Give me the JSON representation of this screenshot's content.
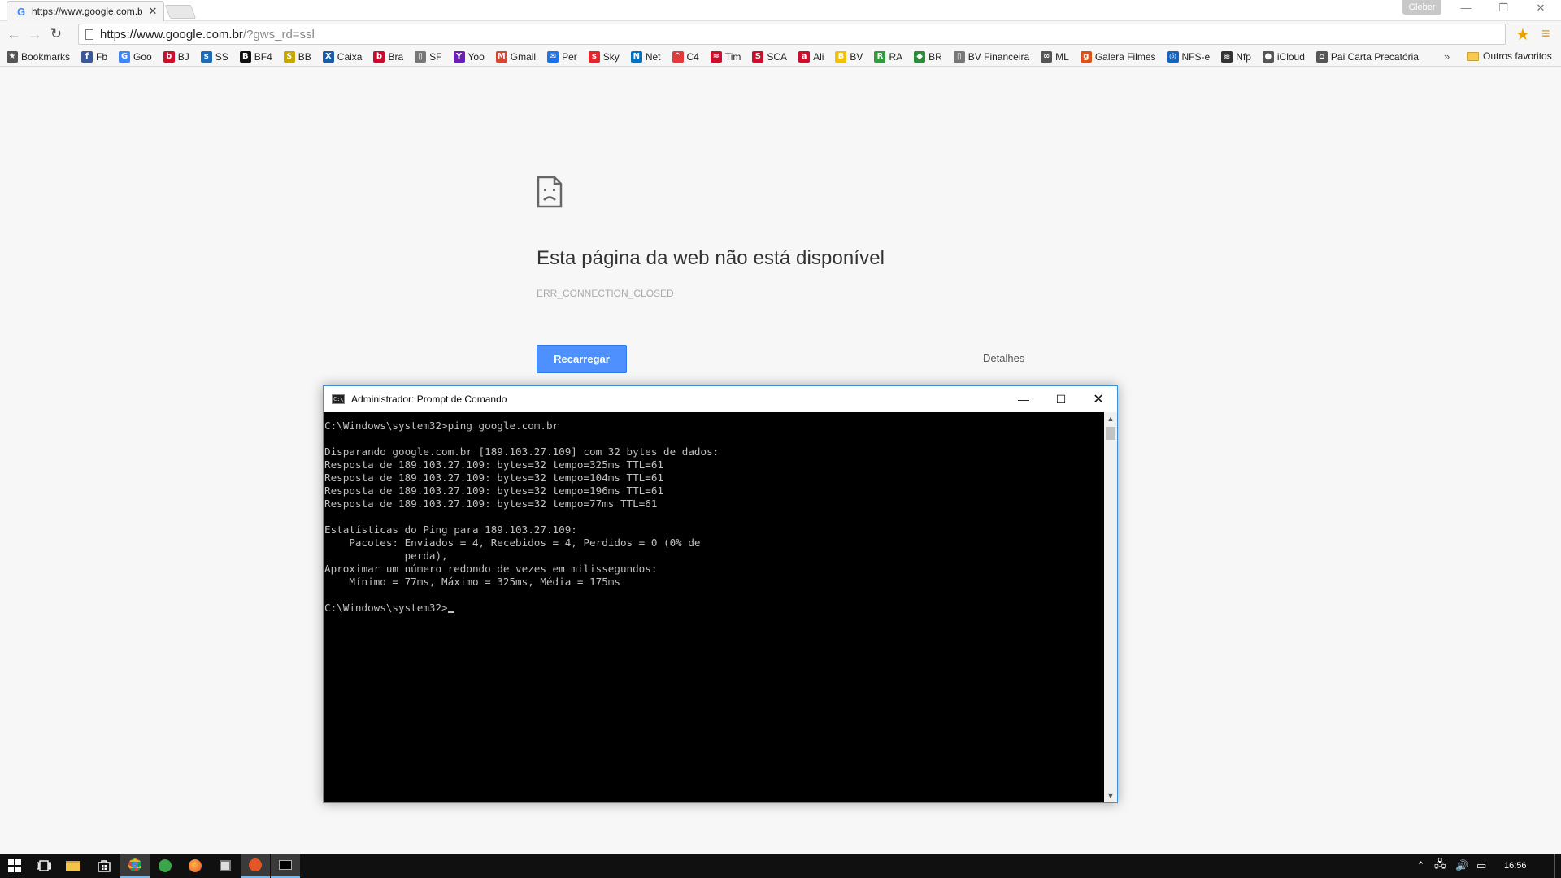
{
  "browser": {
    "tab": {
      "title": "https://www.google.com.b",
      "favicon": "G"
    },
    "profile": "Gleber",
    "url": {
      "host": "https://www.google.com.br",
      "path": "/?gws_rd=ssl"
    }
  },
  "bookmarks": {
    "items": [
      {
        "label": "Bookmarks",
        "icon": "★",
        "color": "#555555"
      },
      {
        "label": "Fb",
        "icon": "f",
        "color": "#3b5998"
      },
      {
        "label": "Goo",
        "icon": "G",
        "color": "#4285f4"
      },
      {
        "label": "BJ",
        "icon": "b",
        "color": "#c8102e"
      },
      {
        "label": "SS",
        "icon": "s",
        "color": "#1e6bb8"
      },
      {
        "label": "BF4",
        "icon": "B",
        "color": "#111111"
      },
      {
        "label": "BB",
        "icon": "$",
        "color": "#c7a500"
      },
      {
        "label": "Caixa",
        "icon": "X",
        "color": "#1c5aa6"
      },
      {
        "label": "Bra",
        "icon": "b",
        "color": "#cc092f"
      },
      {
        "label": "SF",
        "icon": "▯",
        "color": "#777777"
      },
      {
        "label": "Yoo",
        "icon": "Y",
        "color": "#6b1fb1"
      },
      {
        "label": "Gmail",
        "icon": "M",
        "color": "#d14836"
      },
      {
        "label": "Per",
        "icon": "✉",
        "color": "#1a73e8"
      },
      {
        "label": "Sky",
        "icon": "s",
        "color": "#e3262b"
      },
      {
        "label": "Net",
        "icon": "N",
        "color": "#0070c0"
      },
      {
        "label": "C4",
        "icon": "^",
        "color": "#e03a3a"
      },
      {
        "label": "Tim",
        "icon": "≈",
        "color": "#c8102e"
      },
      {
        "label": "SCA",
        "icon": "S",
        "color": "#c8102e"
      },
      {
        "label": "Ali",
        "icon": "a",
        "color": "#c8102e"
      },
      {
        "label": "BV",
        "icon": "B",
        "color": "#f2c200"
      },
      {
        "label": "RA",
        "icon": "R",
        "color": "#2e9d3a"
      },
      {
        "label": "BR",
        "icon": "◆",
        "color": "#2e8b3a"
      },
      {
        "label": "BV Financeira",
        "icon": "▯",
        "color": "#777777"
      },
      {
        "label": "ML",
        "icon": "∞",
        "color": "#555555"
      },
      {
        "label": "Galera Filmes",
        "icon": "g",
        "color": "#d9531e"
      },
      {
        "label": "NFS-e",
        "icon": "◎",
        "color": "#1565c0"
      },
      {
        "label": "Nfp",
        "icon": "≋",
        "color": "#333333"
      },
      {
        "label": "iCloud",
        "icon": "●",
        "color": "#555555"
      },
      {
        "label": "Pai Carta Precatória",
        "icon": "⌂",
        "color": "#555555"
      }
    ],
    "more": "»",
    "other": "Outros favoritos"
  },
  "error_page": {
    "title": "Esta página da web não está disponível",
    "code": "ERR_CONNECTION_CLOSED",
    "reload_label": "Recarregar",
    "details_label": "Detalhes"
  },
  "cmd": {
    "title": "Administrador: Prompt de Comando",
    "icon_text": "C:\\",
    "lines": [
      "C:\\Windows\\system32>ping google.com.br",
      "",
      "Disparando google.com.br [189.103.27.109] com 32 bytes de dados:",
      "Resposta de 189.103.27.109: bytes=32 tempo=325ms TTL=61",
      "Resposta de 189.103.27.109: bytes=32 tempo=104ms TTL=61",
      "Resposta de 189.103.27.109: bytes=32 tempo=196ms TTL=61",
      "Resposta de 189.103.27.109: bytes=32 tempo=77ms TTL=61",
      "",
      "Estatísticas do Ping para 189.103.27.109:",
      "    Pacotes: Enviados = 4, Recebidos = 4, Perdidos = 0 (0% de",
      "             perda),",
      "Aproximar um número redondo de vezes em milissegundos:",
      "    Mínimo = 77ms, Máximo = 325ms, Média = 175ms",
      ""
    ],
    "prompt": "C:\\Windows\\system32>"
  },
  "taskbar": {
    "clock": "16:56"
  },
  "colors": {
    "reload_button": "#4d90fe",
    "cmd_background": "#000000",
    "cmd_text": "#c0c0c0",
    "taskbar": "#101010"
  }
}
